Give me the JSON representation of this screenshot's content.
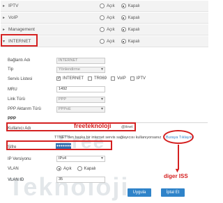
{
  "sections": [
    {
      "title": "IPTV",
      "on": "Açık",
      "off": "Kapalı"
    },
    {
      "title": "VoIP",
      "on": "Açık",
      "off": "Kapalı"
    },
    {
      "title": "Management",
      "on": "Açık",
      "off": "Kapalı"
    },
    {
      "title": "INTERNET",
      "on": "Açık",
      "off": "Kapalı"
    }
  ],
  "form": {
    "baglanti_label": "Bağlantı Adı",
    "baglanti_value": "INTERNET",
    "tip_label": "Tip",
    "tip_value": "Yönlendirme",
    "servis_label": "Servis Listesi",
    "servis_options": [
      "INTERNET",
      "TR069",
      "VoIP",
      "IPTV"
    ],
    "mru_label": "MRU",
    "mru_value": "1492",
    "link_label": "Link Türü",
    "link_value": "PPP",
    "ppp_aktarim_label": "PPP Aktarım Türü",
    "ppp_aktarim_value": "PPPoE",
    "ppp_heading": "PPP",
    "kullanici_label": "Kullanıcı Adı",
    "kullanici_value": "freeteknoloji",
    "kullanici_suffix": "@ttnet",
    "info_text": "TTNET'den başka bir internet servis sağlayıcısı kullanıyorsanız",
    "info_link": "Buraya Tıklayın",
    "sifre_label": "Şifre",
    "sifre_value": "●●●●●●●●",
    "ipver_label": "IP Versiyonu",
    "ipver_value": "IPv4",
    "vlan_label": "VLAN",
    "vlan_on": "Açık",
    "vlan_off": "Kapalı",
    "vlanid_label": "VLAN ID",
    "vlanid_value": "35"
  },
  "buttons": {
    "apply": "Uygula",
    "cancel": "İptal Et"
  },
  "annotation": {
    "label": "diger ISS"
  },
  "watermark": {
    "line1": "Free",
    "line2": "Teknoloji"
  },
  "colors": {
    "accent": "#2f83c9",
    "highlight": "#d42020"
  }
}
